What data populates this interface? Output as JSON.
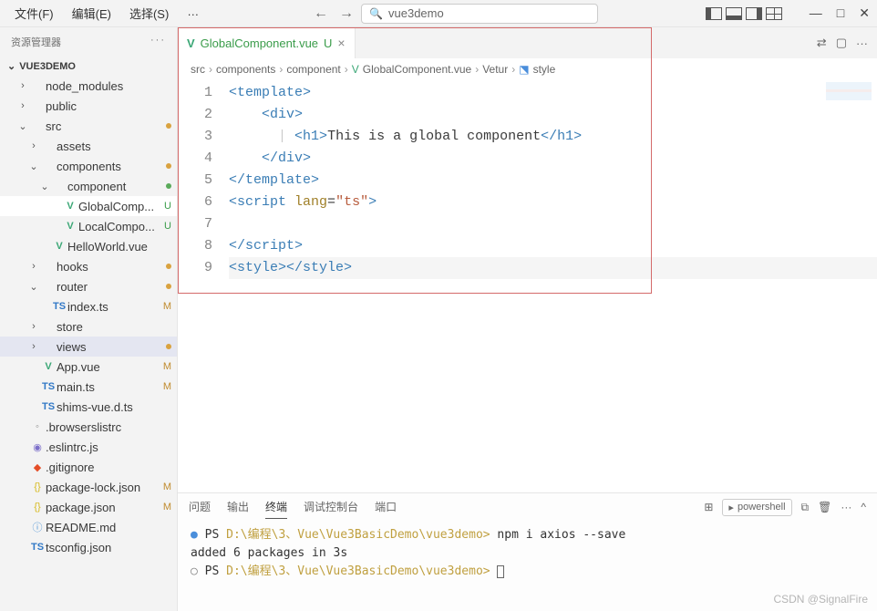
{
  "menu": {
    "file": "文件(F)",
    "edit": "编辑(E)",
    "select": "选择(S)",
    "more": "…"
  },
  "search": {
    "text": "vue3demo"
  },
  "sidebar": {
    "title": "资源管理器",
    "dots": "···",
    "project": "VUE3DEMO",
    "items": [
      {
        "depth": 1,
        "chev": "›",
        "icon": "",
        "label": "node_modules",
        "cls": "",
        "status": ""
      },
      {
        "depth": 1,
        "chev": "›",
        "icon": "",
        "label": "public",
        "cls": "",
        "status": ""
      },
      {
        "depth": 1,
        "chev": "⌄",
        "icon": "",
        "label": "src",
        "cls": "label-M",
        "status": "",
        "dot": "orange"
      },
      {
        "depth": 2,
        "chev": "›",
        "icon": "",
        "label": "assets",
        "cls": "",
        "status": ""
      },
      {
        "depth": 2,
        "chev": "⌄",
        "icon": "",
        "label": "components",
        "cls": "label-M",
        "status": "",
        "dot": "orange"
      },
      {
        "depth": 3,
        "chev": "⌄",
        "icon": "",
        "label": "component",
        "cls": "label-U",
        "status": "",
        "dot": "green"
      },
      {
        "depth": 4,
        "chev": "",
        "icon": "V",
        "iconcls": "vue-icon",
        "label": "GlobalComp...",
        "cls": "label-U",
        "status": "U",
        "statuscls": "status-U",
        "sel": true
      },
      {
        "depth": 4,
        "chev": "",
        "icon": "V",
        "iconcls": "vue-icon",
        "label": "LocalCompo...",
        "cls": "label-U",
        "status": "U",
        "statuscls": "status-U"
      },
      {
        "depth": 3,
        "chev": "",
        "icon": "V",
        "iconcls": "vue-icon",
        "label": "HelloWorld.vue",
        "cls": "",
        "status": ""
      },
      {
        "depth": 2,
        "chev": "›",
        "icon": "",
        "label": "hooks",
        "cls": "label-M",
        "status": "",
        "dot": "orange"
      },
      {
        "depth": 2,
        "chev": "⌄",
        "icon": "",
        "label": "router",
        "cls": "label-M",
        "status": "",
        "dot": "orange"
      },
      {
        "depth": 3,
        "chev": "",
        "icon": "TS",
        "iconcls": "ts-icon",
        "label": "index.ts",
        "cls": "label-M",
        "status": "M",
        "statuscls": "status-M"
      },
      {
        "depth": 2,
        "chev": "›",
        "icon": "",
        "label": "store",
        "cls": "",
        "status": ""
      },
      {
        "depth": 2,
        "chev": "›",
        "icon": "",
        "label": "views",
        "cls": "label-M",
        "status": "",
        "dot": "orange",
        "selbg": true
      },
      {
        "depth": 2,
        "chev": "",
        "icon": "V",
        "iconcls": "vue-icon",
        "label": "App.vue",
        "cls": "label-M",
        "status": "M",
        "statuscls": "status-M"
      },
      {
        "depth": 2,
        "chev": "",
        "icon": "TS",
        "iconcls": "ts-icon",
        "label": "main.ts",
        "cls": "label-M",
        "status": "M",
        "statuscls": "status-M"
      },
      {
        "depth": 2,
        "chev": "",
        "icon": "TS",
        "iconcls": "ts-icon",
        "label": "shims-vue.d.ts",
        "cls": "",
        "status": ""
      },
      {
        "depth": 1,
        "chev": "",
        "icon": "◦",
        "iconcls": "gray-icon",
        "label": ".browserslistrc",
        "cls": "",
        "status": ""
      },
      {
        "depth": 1,
        "chev": "",
        "icon": "◉",
        "iconcls": "eslint-icon",
        "label": ".eslintrc.js",
        "cls": "",
        "status": ""
      },
      {
        "depth": 1,
        "chev": "",
        "icon": "◆",
        "iconcls": "git-icon",
        "label": ".gitignore",
        "cls": "",
        "status": ""
      },
      {
        "depth": 1,
        "chev": "",
        "icon": "{}",
        "iconcls": "json-icon",
        "label": "package-lock.json",
        "cls": "label-M",
        "status": "M",
        "statuscls": "status-M"
      },
      {
        "depth": 1,
        "chev": "",
        "icon": "{}",
        "iconcls": "json-icon",
        "label": "package.json",
        "cls": "label-M",
        "status": "M",
        "statuscls": "status-M"
      },
      {
        "depth": 1,
        "chev": "",
        "icon": "ⓘ",
        "iconcls": "md-icon",
        "label": "README.md",
        "cls": "",
        "status": ""
      },
      {
        "depth": 1,
        "chev": "",
        "icon": "TS",
        "iconcls": "ts-icon",
        "label": "tsconfig.json",
        "cls": "",
        "status": ""
      }
    ]
  },
  "tab": {
    "label": "GlobalComponent.vue",
    "status": "U"
  },
  "breadcrumb": {
    "parts": [
      "src",
      "components",
      "component",
      "GlobalComponent.vue",
      "Vetur",
      "style"
    ]
  },
  "code": {
    "lines": [
      {
        "n": "1",
        "html": "<span class='tok-tag'>&lt;template&gt;</span>"
      },
      {
        "n": "2",
        "html": "    <span class='tok-tag'>&lt;div&gt;</span>"
      },
      {
        "n": "3",
        "html": "      <span style='color:#ccc'>|</span> <span class='tok-tag'>&lt;h1&gt;</span><span class='tok-text'>This is a global component</span><span class='tok-tag'>&lt;/h1&gt;</span>"
      },
      {
        "n": "4",
        "html": "    <span class='tok-tag'>&lt;/div&gt;</span>"
      },
      {
        "n": "5",
        "html": "<span class='tok-tag'>&lt;/template&gt;</span>"
      },
      {
        "n": "6",
        "html": "<span class='tok-tag'>&lt;script</span> <span class='tok-attr'>lang</span>=<span class='tok-str'>\"ts\"</span><span class='tok-tag'>&gt;</span>"
      },
      {
        "n": "7",
        "html": ""
      },
      {
        "n": "8",
        "html": "<span class='tok-tag'>&lt;/script&gt;</span>"
      },
      {
        "n": "9",
        "html": "<span class='tok-tag'>&lt;style&gt;&lt;/style&gt;</span>",
        "current": true
      }
    ]
  },
  "panel": {
    "tabs": [
      "问题",
      "输出",
      "终端",
      "调试控制台",
      "端口"
    ],
    "active": 2,
    "shell": "powershell",
    "lines": [
      {
        "dot": "●",
        "dotcls": "prompt-dot",
        "prefix": "PS ",
        "path": "D:\\编程\\3、Vue\\Vue3BasicDemo\\vue3demo>",
        "cmd": " npm i axios --save"
      },
      {
        "plain": ""
      },
      {
        "plain": "added 6 packages in 3s"
      },
      {
        "dot": "○",
        "dotcls": "prompt-dim",
        "prefix": "PS ",
        "path": "D:\\编程\\3、Vue\\Vue3BasicDemo\\vue3demo>",
        "cursor": true
      }
    ]
  },
  "watermark": "CSDN @SignalFire"
}
